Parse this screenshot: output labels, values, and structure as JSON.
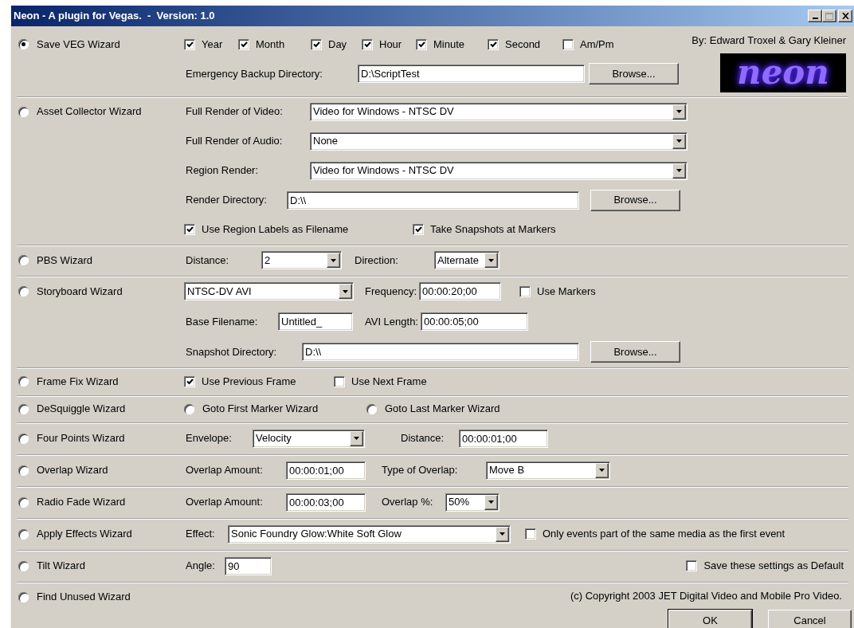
{
  "window": {
    "title": "Neon - A plugin for Vegas.  -  Version: 1.0"
  },
  "credits": "By: Edward Troxel & Gary Kleiner",
  "logo": "neon",
  "wizards": [
    {
      "label": "Save VEG Wizard",
      "selected": true,
      "lines": [
        [
          {
            "kind": "checkbox",
            "label": "Year",
            "checked": true
          },
          {
            "kind": "checkbox",
            "label": "Month",
            "checked": true
          },
          {
            "kind": "checkbox",
            "label": "Day",
            "checked": true
          },
          {
            "kind": "checkbox",
            "label": "Hour",
            "checked": true
          },
          {
            "kind": "checkbox",
            "label": "Minute",
            "checked": true
          },
          {
            "kind": "checkbox",
            "label": "Second",
            "checked": true
          },
          {
            "kind": "checkbox",
            "label": "Am/Pm",
            "checked": false
          }
        ],
        [
          {
            "kind": "label",
            "text": "Emergency Backup Directory:"
          },
          {
            "kind": "input",
            "value": "D:\\ScriptTest"
          },
          {
            "kind": "button",
            "label": "Browse..."
          }
        ]
      ]
    },
    {
      "label": "Asset Collector Wizard",
      "selected": false,
      "lines": [
        [
          {
            "kind": "label",
            "text": "Full Render of Video:"
          },
          {
            "kind": "select",
            "value": "Video for Windows - NTSC DV"
          }
        ],
        [
          {
            "kind": "label",
            "text": "Full Render of Audio:"
          },
          {
            "kind": "select",
            "value": "None"
          }
        ],
        [
          {
            "kind": "label",
            "text": "Region Render:"
          },
          {
            "kind": "select",
            "value": "Video for Windows - NTSC DV"
          }
        ],
        [
          {
            "kind": "label",
            "text": "Render Directory:"
          },
          {
            "kind": "input",
            "value": "D:\\\\"
          },
          {
            "kind": "button",
            "label": "Browse..."
          }
        ],
        [
          {
            "kind": "checkbox",
            "label": "Use Region Labels as Filename",
            "checked": true
          },
          {
            "kind": "checkbox",
            "label": "Take Snapshots at Markers",
            "checked": true
          }
        ]
      ]
    },
    {
      "label": "PBS Wizard",
      "selected": false,
      "lines": [
        [
          {
            "kind": "label",
            "text": "Distance:"
          },
          {
            "kind": "select",
            "value": "2"
          },
          {
            "kind": "label",
            "text": "Direction:"
          },
          {
            "kind": "select",
            "value": "Alternate"
          }
        ]
      ]
    },
    {
      "label": "Storyboard Wizard",
      "selected": false,
      "lines": [
        [
          {
            "kind": "select",
            "value": "NTSC-DV AVI"
          },
          {
            "kind": "label",
            "text": "Frequency:"
          },
          {
            "kind": "input",
            "value": "00:00:20;00"
          },
          {
            "kind": "checkbox",
            "label": "Use Markers",
            "checked": false
          }
        ],
        [
          {
            "kind": "label",
            "text": "Base Filename:"
          },
          {
            "kind": "input",
            "value": "Untitled_"
          },
          {
            "kind": "label",
            "text": "AVI Length:"
          },
          {
            "kind": "input",
            "value": "00:00:05;00"
          }
        ],
        [
          {
            "kind": "label",
            "text": "Snapshot Directory:"
          },
          {
            "kind": "input",
            "value": "D:\\\\"
          },
          {
            "kind": "button",
            "label": "Browse..."
          }
        ]
      ]
    },
    {
      "label": "Frame Fix Wizard",
      "selected": false,
      "lines": [
        [
          {
            "kind": "checkbox",
            "label": "Use Previous Frame",
            "checked": true
          },
          {
            "kind": "checkbox",
            "label": "Use Next Frame",
            "checked": false
          }
        ]
      ]
    },
    {
      "label": "DeSquiggle Wizard",
      "selected": false,
      "lines": [
        [
          {
            "kind": "radio",
            "label": "Goto First Marker Wizard",
            "selected": false
          },
          {
            "kind": "radio",
            "label": "Goto Last Marker Wizard",
            "selected": false
          }
        ]
      ]
    },
    {
      "label": "Four Points Wizard",
      "selected": false,
      "lines": [
        [
          {
            "kind": "label",
            "text": "Envelope:"
          },
          {
            "kind": "select",
            "value": "Velocity"
          },
          {
            "kind": "label",
            "text": "Distance:"
          },
          {
            "kind": "input",
            "value": "00:00:01;00"
          }
        ]
      ]
    },
    {
      "label": "Overlap Wizard",
      "selected": false,
      "lines": [
        [
          {
            "kind": "label",
            "text": "Overlap Amount:"
          },
          {
            "kind": "input",
            "value": "00:00:01;00"
          },
          {
            "kind": "label",
            "text": "Type of Overlap:"
          },
          {
            "kind": "select",
            "value": "Move B"
          }
        ]
      ]
    },
    {
      "label": "Radio Fade Wizard",
      "selected": false,
      "lines": [
        [
          {
            "kind": "label",
            "text": "Overlap Amount:"
          },
          {
            "kind": "input",
            "value": "00:00:03;00"
          },
          {
            "kind": "label",
            "text": "Overlap %:"
          },
          {
            "kind": "select",
            "value": "50%"
          }
        ]
      ]
    },
    {
      "label": "Apply Effects Wizard",
      "selected": false,
      "lines": [
        [
          {
            "kind": "label",
            "text": "Effect:"
          },
          {
            "kind": "select",
            "value": "Sonic Foundry Glow:White Soft Glow"
          },
          {
            "kind": "checkbox",
            "label": "Only events part of the same media as the first event",
            "checked": false
          }
        ]
      ]
    },
    {
      "label": "Tilt Wizard",
      "selected": false,
      "lines": [
        [
          {
            "kind": "label",
            "text": "Angle:"
          },
          {
            "kind": "input",
            "value": "90"
          },
          {
            "kind": "checkbox",
            "label": "Save these settings as Default",
            "checked": false
          }
        ]
      ]
    },
    {
      "label": "Find Unused Wizard",
      "selected": false
    }
  ],
  "copyright": "(c) Copyright 2003 JET Digital Video and Mobile Pro Video.",
  "buttons": [
    {
      "label": "OK",
      "default": true
    },
    {
      "label": "Cancel",
      "default": false
    }
  ]
}
